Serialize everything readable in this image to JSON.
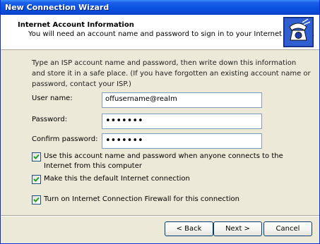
{
  "window": {
    "title": "New Connection Wizard"
  },
  "header": {
    "title": "Internet Account Information",
    "subtitle": "You will need an account name and password to sign in to your Internet account.",
    "icon": "wizard-phone-icon"
  },
  "intro": "Type an ISP account name and password, then write down this information and store it in a safe place. (If you have forgotten an existing account name or password, contact your ISP.)",
  "fields": {
    "username": {
      "label": "User name:",
      "value": "offusername@realm"
    },
    "password": {
      "label": "Password:",
      "value": "•••••••"
    },
    "confirm": {
      "label": "Confirm password:",
      "value": "•••••••"
    }
  },
  "checkboxes": [
    {
      "label": "Use this account  name and password when anyone connects to the Internet from this computer",
      "checked": true
    },
    {
      "label": "Make this the default Internet connection",
      "checked": true
    },
    {
      "label": "Turn on Internet Connection Firewall for this connection",
      "checked": true
    }
  ],
  "buttons": {
    "back": "< Back",
    "next": "Next >",
    "cancel": "Cancel"
  },
  "colors": {
    "titlebar": "#0a53e0",
    "dialog_bg": "#ece9d8",
    "header_bg": "#ffffff",
    "button_border": "#003c74"
  }
}
